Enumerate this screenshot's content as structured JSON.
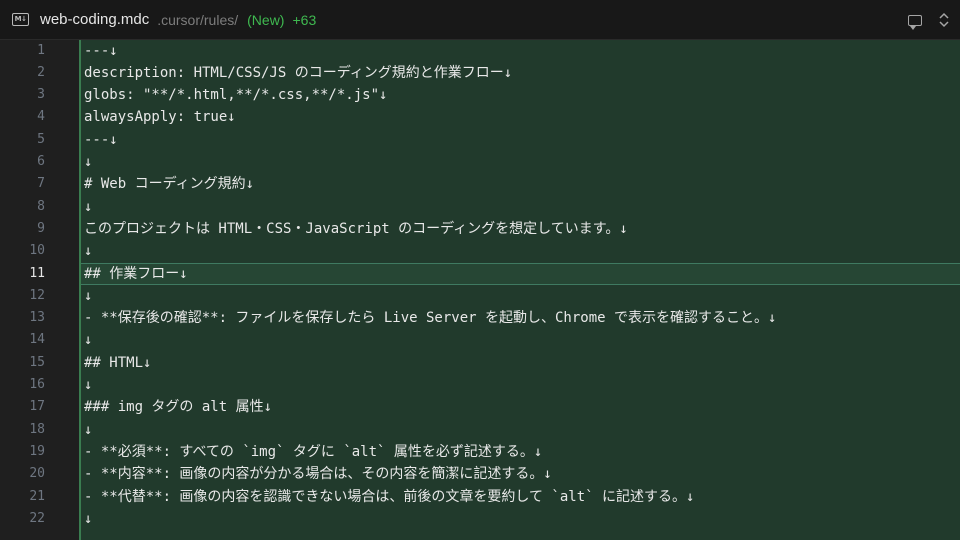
{
  "header": {
    "file_icon_text": "M↓",
    "file_name": "web-coding.mdc",
    "file_path": ".cursor/rules/",
    "status": "(New)",
    "added_lines": "+63"
  },
  "editor": {
    "active_line": 11,
    "lines": [
      {
        "number": "1",
        "text": "---↓"
      },
      {
        "number": "2",
        "text": "description: HTML/CSS/JS のコーディング規約と作業フロー↓"
      },
      {
        "number": "3",
        "text": "globs: \"**/*.html,**/*.css,**/*.js\"↓"
      },
      {
        "number": "4",
        "text": "alwaysApply: true↓"
      },
      {
        "number": "5",
        "text": "---↓"
      },
      {
        "number": "6",
        "text": "↓"
      },
      {
        "number": "7",
        "text": "# Web コーディング規約↓"
      },
      {
        "number": "8",
        "text": "↓"
      },
      {
        "number": "9",
        "text": "このプロジェクトは HTML・CSS・JavaScript のコーディングを想定しています。↓"
      },
      {
        "number": "10",
        "text": "↓"
      },
      {
        "number": "11",
        "text": "## 作業フロー↓"
      },
      {
        "number": "12",
        "text": "↓"
      },
      {
        "number": "13",
        "text": "- **保存後の確認**: ファイルを保存したら Live Server を起動し、Chrome で表示を確認すること。↓"
      },
      {
        "number": "14",
        "text": "↓"
      },
      {
        "number": "15",
        "text": "## HTML↓"
      },
      {
        "number": "16",
        "text": "↓"
      },
      {
        "number": "17",
        "text": "### img タグの alt 属性↓"
      },
      {
        "number": "18",
        "text": "↓"
      },
      {
        "number": "19",
        "text": "- **必須**: すべての `img` タグに `alt` 属性を必ず記述する。↓"
      },
      {
        "number": "20",
        "text": "- **内容**: 画像の内容が分かる場合は、その内容を簡潔に記述する。↓"
      },
      {
        "number": "21",
        "text": "- **代替**: 画像の内容を認識できない場合は、前後の文章を要約して `alt` に記述する。↓"
      },
      {
        "number": "22",
        "text": "↓"
      }
    ]
  }
}
